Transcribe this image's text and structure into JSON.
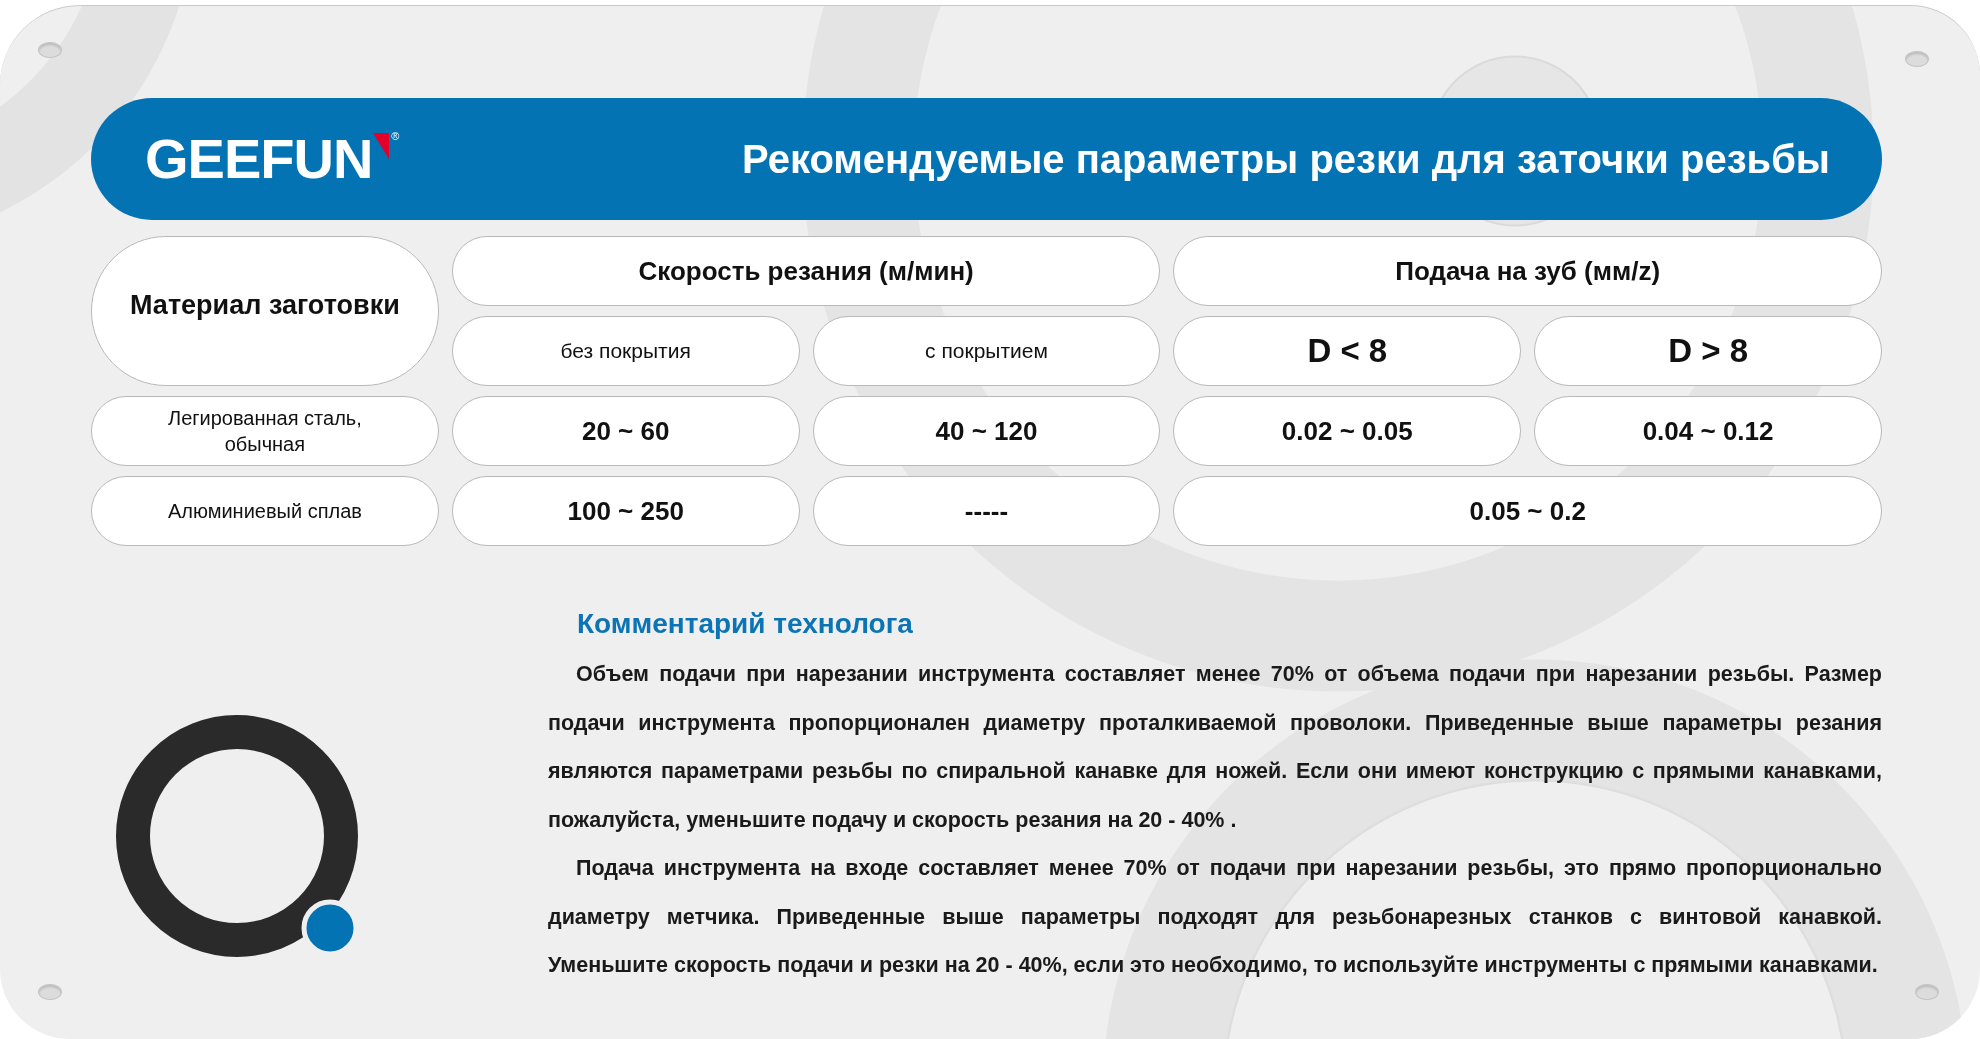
{
  "header": {
    "logo": {
      "text": "GEEFUN",
      "mark": "®"
    },
    "title": "Рекомендуемые параметры резки для заточки резьбы"
  },
  "table": {
    "corner_header": "Материал заготовки",
    "groups": [
      {
        "label": "Скорость резания (м/мин)",
        "kind": "coating",
        "columns": [
          "без покрытия",
          "с покрытием"
        ]
      },
      {
        "label": "Подача на зуб (мм/z)",
        "kind": "diameter",
        "columns": [
          "D < 8",
          "D > 8"
        ]
      }
    ],
    "rows": [
      {
        "material": "Легированная сталь, обычная",
        "values": [
          [
            "20 ~ 60",
            "40 ~ 120"
          ],
          [
            "0.02 ~ 0.05",
            "0.04 ~ 0.12"
          ]
        ]
      },
      {
        "material": "Алюминиевый сплав",
        "values": [
          [
            "100 ~ 250",
            "-----"
          ],
          [
            "0.05 ~ 0.2"
          ]
        ]
      }
    ]
  },
  "comment": {
    "title": "Комментарий технолога",
    "paragraphs": [
      "Объем подачи при нарезании инструмента составляет менее 70% от объема подачи при нарезании резьбы. Размер подачи инструмента пропорционален диаметру проталкиваемой проволоки. Приведенные выше параметры резания являются параметрами резьбы по спиральной канавке для ножей. Если они имеют конструкцию с прямыми канавками, пожалуйста, уменьшите подачу и скорость резания на 20 - 40% .",
      "Подача инструмента на входе составляет менее 70% от подачи при нарезании резьбы, это прямо пропорционально диаметру метчика. Приведенные выше параметры подходят для резьбонарезных станков с винтовой канавкой. Уменьшите скорость подачи и резки на 20 - 40%, если это необходимо, то используйте инструменты с прямыми канавками."
    ]
  }
}
